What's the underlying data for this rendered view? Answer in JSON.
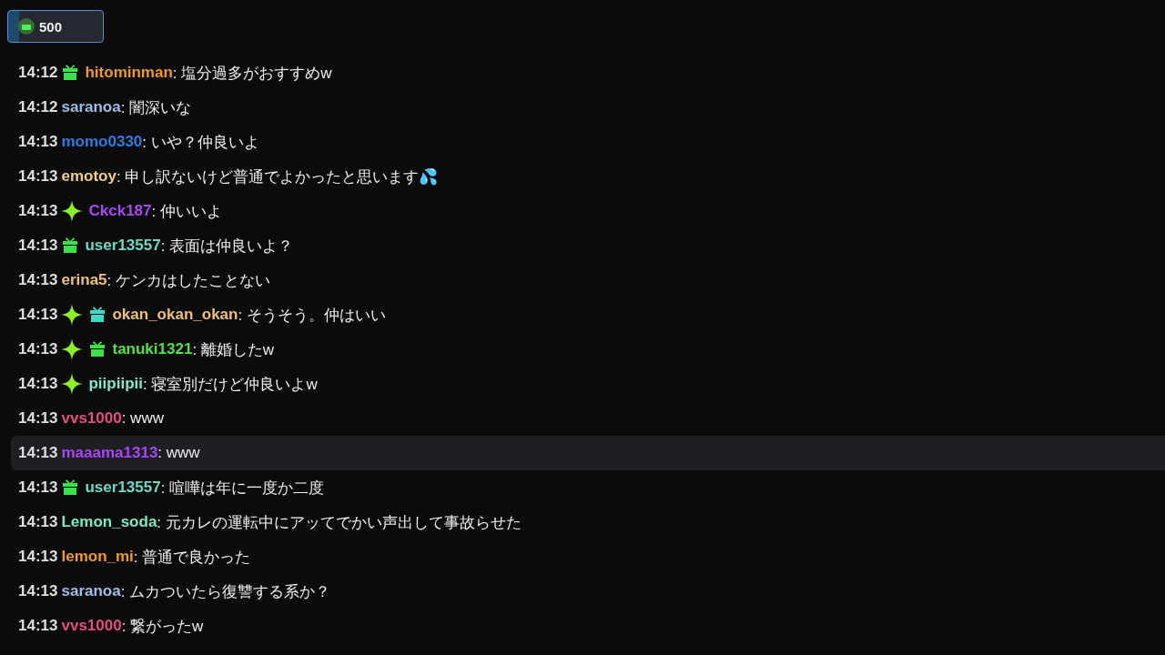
{
  "points_button": {
    "label": "500"
  },
  "messages": [
    {
      "time": "14:12",
      "badges": [
        {
          "kind": "gift",
          "color": "#3ee04a"
        }
      ],
      "user": "hitominman",
      "color": "#f29a1e",
      "text": ": 塩分過多がおすすめw",
      "selected": false
    },
    {
      "time": "14:12",
      "user": "saranoa",
      "color": "#9fbde8",
      "text": ": 闇深いな",
      "selected": false
    },
    {
      "time": "14:13",
      "user": "momo0330",
      "color": "#2f7be0",
      "text": ": いや？仲良いよ",
      "selected": false
    },
    {
      "time": "14:13",
      "user": "emotoy",
      "color": "#f0cf8a",
      "text": ": 申し訳ないけど普通でよかったと思います💦",
      "selected": false
    },
    {
      "time": "14:13",
      "badges": [
        {
          "kind": "sparkle",
          "color": "#8cf02a"
        }
      ],
      "user": "Ckck187",
      "color": "#a649f0",
      "text": ": 仲いいよ",
      "selected": false
    },
    {
      "time": "14:13",
      "badges": [
        {
          "kind": "gift",
          "color": "#3ee04a"
        }
      ],
      "user": "user13557",
      "color": "#6fd9c4",
      "text": ": 表面は仲良いよ？",
      "selected": false
    },
    {
      "time": "14:13",
      "user": "erina5",
      "color": "#f0c07a",
      "text": ": ケンカはしたことない",
      "selected": false
    },
    {
      "time": "14:13",
      "badges": [
        {
          "kind": "sparkle",
          "color": "#8cf02a"
        },
        {
          "kind": "gift",
          "color": "#3ed9c8"
        }
      ],
      "user": "okan_okan_okan",
      "color": "#f0c07a",
      "text": ": そうそう。仲はいい",
      "selected": false
    },
    {
      "time": "14:13",
      "badges": [
        {
          "kind": "sparkle",
          "color": "#8cf02a"
        },
        {
          "kind": "gift",
          "color": "#3ee04a"
        }
      ],
      "user": "tanuki1321",
      "color": "#58e04a",
      "text": ": 離婚したw",
      "selected": false
    },
    {
      "time": "14:13",
      "badges": [
        {
          "kind": "sparkle",
          "color": "#8cf02a"
        }
      ],
      "user": "piipiipii",
      "color": "#7fe8d0",
      "text": ": 寝室別だけど仲良いよw",
      "selected": false
    },
    {
      "time": "14:13",
      "user": "vvs1000",
      "color": "#e0507a",
      "text": ": www",
      "selected": false
    },
    {
      "time": "14:13",
      "user": "maaama1313",
      "color": "#a649f0",
      "text": ": www",
      "selected": true
    },
    {
      "time": "14:13",
      "badges": [
        {
          "kind": "gift",
          "color": "#3ee04a"
        }
      ],
      "user": "user13557",
      "color": "#6fd9c4",
      "text": ": 喧嘩は年に一度か二度",
      "selected": false
    },
    {
      "time": "14:13",
      "user": "Lemon_soda",
      "color": "#7fe8c8",
      "text": ": 元カレの運転中にアッてでかい声出して事故らせた",
      "selected": false
    },
    {
      "time": "14:13",
      "user": "lemon_mi",
      "color": "#f29a1e",
      "text": ": 普通で良かった",
      "selected": false
    },
    {
      "time": "14:13",
      "user": "saranoa",
      "color": "#9fbde8",
      "text": ": ムカついたら復讐する系か？",
      "selected": false
    },
    {
      "time": "14:13",
      "user": "vvs1000",
      "color": "#e0507a",
      "text": ": 繋がったw",
      "selected": false
    }
  ]
}
